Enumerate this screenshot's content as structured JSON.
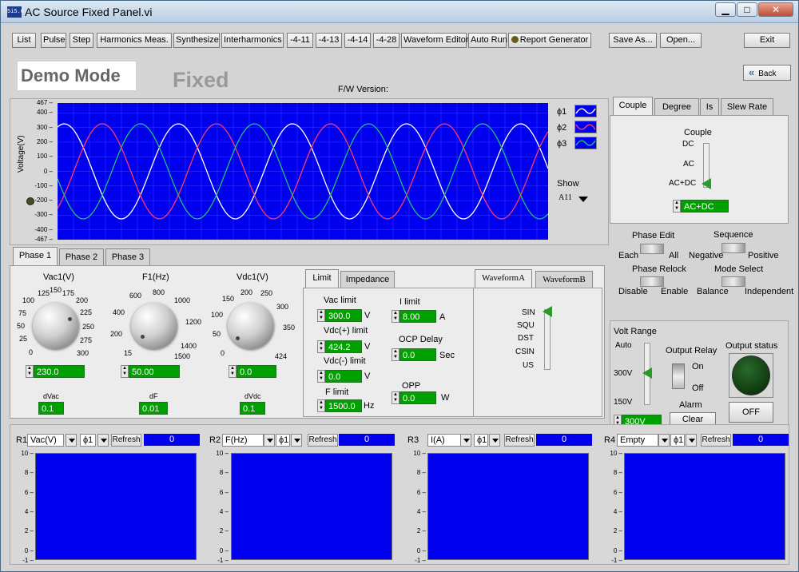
{
  "window": {
    "title": "AC Source Fixed Panel.vi",
    "app_icon_text": "5i5.6"
  },
  "toolbar": {
    "buttons": [
      "List",
      "Pulse",
      "Step",
      "Harmonics Meas.",
      "Synthesize",
      "Interharmonics",
      "-4-11",
      "-4-13",
      "-4-14",
      "-4-28",
      "Waveform Editor",
      "Auto Run",
      "Report Generator",
      "Save As...",
      "Open...",
      "Exit"
    ]
  },
  "header": {
    "mode": "Demo Mode",
    "panel_type": "Fixed",
    "fw_label": "F/W Version:",
    "fw_value": "",
    "back": "Back"
  },
  "graph": {
    "ylabel": "Voltage(V)",
    "yticks": [
      "467",
      "400",
      "300",
      "200",
      "100",
      "0",
      "-100",
      "-200",
      "-300",
      "-400",
      "-467"
    ],
    "legend": [
      "ϕ1",
      "ϕ2",
      "ϕ3"
    ],
    "show_label": "Show",
    "show_value": "A11",
    "colors": {
      "phase1": "#ffffff",
      "phase2": "#ff3a6a",
      "phase3": "#20c070"
    }
  },
  "chart_data": {
    "type": "line",
    "ylabel": "Voltage(V)",
    "ylim": [
      -467,
      467
    ],
    "amplitude": 325,
    "series": [
      {
        "name": "ϕ1",
        "phase_deg": 0,
        "color": "#ffffff"
      },
      {
        "name": "ϕ2",
        "phase_deg": -120,
        "color": "#ff3a6a"
      },
      {
        "name": "ϕ3",
        "phase_deg": 120,
        "color": "#20c070"
      }
    ],
    "cycles": 4.3
  },
  "right_tabs": [
    "Couple",
    "Degree",
    "Is",
    "Slew Rate"
  ],
  "couple": {
    "title": "Couple",
    "options": [
      "DC",
      "AC",
      "AC+DC"
    ],
    "value": "AC+DC"
  },
  "phase_edit": {
    "title": "Phase Edit",
    "left": "Each",
    "right": "All"
  },
  "sequence": {
    "title": "Sequence",
    "left": "Negative",
    "right": "Positive"
  },
  "phase_relock": {
    "title": "Phase Relock",
    "left": "Disable",
    "right": "Enable"
  },
  "mode_select": {
    "title": "Mode Select",
    "left": "Balance",
    "right": "Independent"
  },
  "volt_range": {
    "title": "Volt Range",
    "options": [
      "Auto",
      "300V",
      "150V"
    ],
    "value": "300V"
  },
  "output_relay": {
    "title": "Output Relay",
    "on": "On",
    "off": "Off"
  },
  "alarm": {
    "title": "Alarm",
    "button": "Clear"
  },
  "output_status": {
    "title": "Output status",
    "button": "OFF"
  },
  "phase_tabs": [
    "Phase 1",
    "Phase 2",
    "Phase 3"
  ],
  "knobs": [
    {
      "label": "Vac1(V)",
      "ticks": [
        "0",
        "25",
        "50",
        "75",
        "100",
        "125",
        "150",
        "175",
        "200",
        "225",
        "250",
        "275",
        "300"
      ],
      "value": "230.0",
      "delta_label": "dVac",
      "delta": "0.1"
    },
    {
      "label": "F1(Hz)",
      "ticks": [
        "15",
        "200",
        "400",
        "600",
        "800",
        "1000",
        "1200",
        "1400",
        "1500"
      ],
      "value": "50.00",
      "delta_label": "dF",
      "delta": "0.01"
    },
    {
      "label": "Vdc1(V)",
      "ticks": [
        "0",
        "50",
        "100",
        "150",
        "200",
        "250",
        "300",
        "350",
        "424"
      ],
      "value": "0.0",
      "delta_label": "dVdc",
      "delta": "0.1"
    }
  ],
  "limit_tabs": [
    "Limit",
    "Impedance"
  ],
  "limits": {
    "vac": {
      "label": "Vac limit",
      "value": "300.0",
      "unit": "V"
    },
    "vdcp": {
      "label": "Vdc(+) limit",
      "value": "424.2",
      "unit": "V"
    },
    "vdcm": {
      "label": "Vdc(-) limit",
      "value": "0.0",
      "unit": "V"
    },
    "f": {
      "label": "F limit",
      "value": "1500.0",
      "unit": "Hz"
    },
    "i": {
      "label": "I limit",
      "value": "8.00",
      "unit": "A"
    },
    "ocp": {
      "label": "OCP Delay",
      "value": "0.0",
      "unit": "Sec"
    },
    "opp": {
      "label": "OPP",
      "value": "0.0",
      "unit": "W"
    }
  },
  "waveform_tabs": [
    "WaveformA",
    "WaveformB"
  ],
  "waveform": {
    "options": [
      "SIN",
      "SQU",
      "DST",
      "CSIN",
      "US"
    ],
    "value": "SIN"
  },
  "readouts": [
    {
      "id": "R1",
      "measure": "Vac(V)",
      "phase": "ϕ1",
      "refresh": "Refresh",
      "value": "0"
    },
    {
      "id": "R2",
      "measure": "F(Hz)",
      "phase": "ϕ1",
      "refresh": "Refresh",
      "value": "0"
    },
    {
      "id": "R3",
      "measure": "I(A)",
      "phase": "ϕ1",
      "refresh": "Refresh",
      "value": "0"
    },
    {
      "id": "R4",
      "measure": "Empty",
      "phase": "ϕ1",
      "refresh": "Refresh",
      "value": "0"
    }
  ],
  "readout_yticks": [
    "10",
    "8",
    "6",
    "4",
    "2",
    "0",
    "-1"
  ]
}
